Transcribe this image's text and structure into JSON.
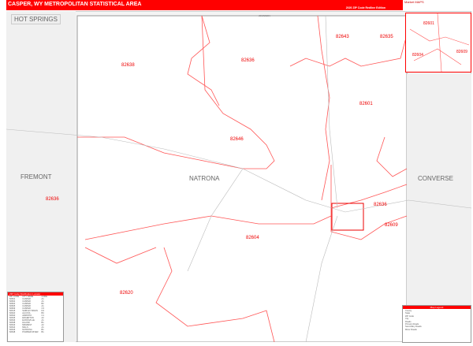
{
  "header": {
    "title": "CASPER, WY METROPOLITAN STATISTICAL AREA",
    "edition": "2020 ZIP Code Redline Edition",
    "logo": "Market MAPS"
  },
  "counties": {
    "hot_springs": "HOT SPRINGS",
    "fremont": "FREMONT",
    "natrona": "NATRONA",
    "converse": "CONVERSE",
    "johnson": "JOHNSON"
  },
  "zips": [
    "82638",
    "82636",
    "82643",
    "82635",
    "82601",
    "82646",
    "82636",
    "82604",
    "82609",
    "82620",
    "82636"
  ],
  "inset_zips": [
    "82601",
    "82609",
    "82604"
  ],
  "legend": {
    "title": "ZIP Code Distribution Locator",
    "columns": [
      "ZIP CODE",
      "CITY NAME",
      "CODE"
    ],
    "rows": [
      [
        "82601",
        "CASPER",
        "A1"
      ],
      [
        "82602",
        "CASPER",
        "A1"
      ],
      [
        "82604",
        "CASPER",
        "B2"
      ],
      [
        "82605",
        "CASPER",
        "A1"
      ],
      [
        "82609",
        "CASPER",
        "C3"
      ],
      [
        "82615",
        "SHIRLEY BASIN",
        "D4"
      ],
      [
        "82620",
        "ALCOVA",
        "B3"
      ],
      [
        "82630",
        "ARMINTO",
        "C1"
      ],
      [
        "82635",
        "EDGERTON",
        "A2"
      ],
      [
        "82636",
        "EVANSVILLE",
        "A1"
      ],
      [
        "82638",
        "HILAND",
        "B1"
      ],
      [
        "82643",
        "MIDWEST",
        "A2"
      ],
      [
        "82644",
        "MILLS",
        "A1"
      ],
      [
        "82646",
        "NATRONA",
        "B1"
      ],
      [
        "82648",
        "POWDER RIVER",
        "B1"
      ]
    ]
  },
  "key": {
    "title": "Map Legend",
    "items": [
      "County",
      "State",
      "ZIP Code",
      "City",
      "Roads",
      "Primary Roads",
      "Secondary Roads",
      "Minor Roads"
    ]
  },
  "colors": {
    "accent": "#ff0000"
  }
}
